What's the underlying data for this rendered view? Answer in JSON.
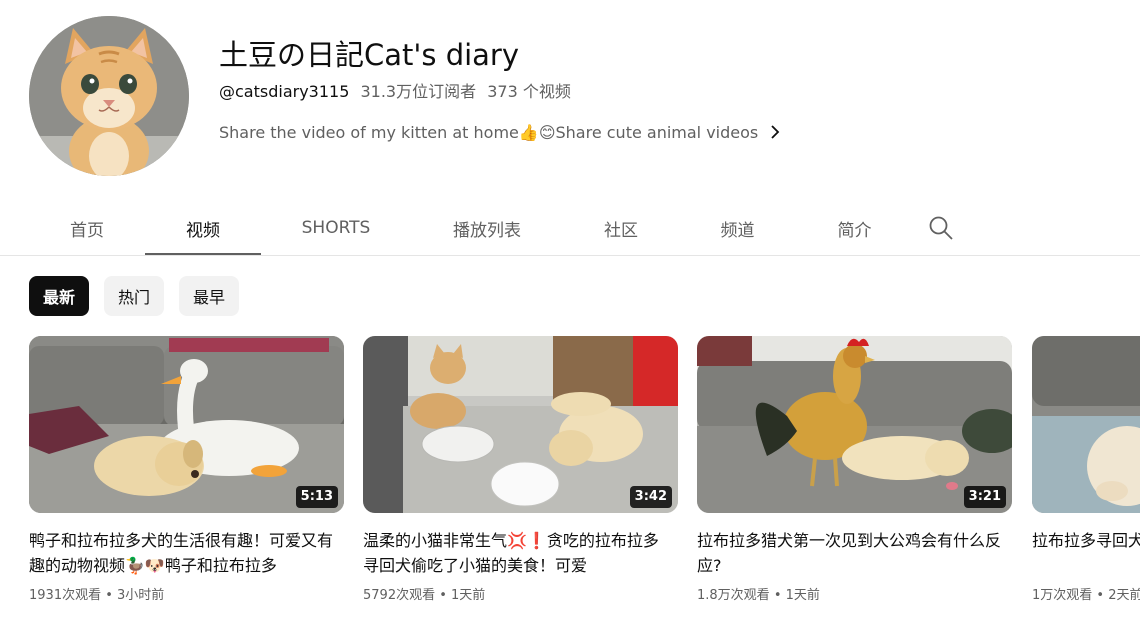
{
  "channel": {
    "title": "土豆の日記Cat's diary",
    "handle": "@catsdiary3115",
    "subscribers": "31.3万位订阅者",
    "video_count": "373 个视频",
    "description": "Share the video of my kitten at home👍😊Share cute animal videos",
    "avatar_icon": "kitten-photo",
    "more_icon": "chevron-right-icon"
  },
  "tabs": [
    {
      "label": "首页",
      "active": false
    },
    {
      "label": "视频",
      "active": true
    },
    {
      "label": "SHORTS",
      "active": false
    },
    {
      "label": "播放列表",
      "active": false
    },
    {
      "label": "社区",
      "active": false
    },
    {
      "label": "频道",
      "active": false
    },
    {
      "label": "简介",
      "active": false
    }
  ],
  "search_icon": "search-icon",
  "chips": [
    {
      "label": "最新",
      "active": true
    },
    {
      "label": "热门",
      "active": false
    },
    {
      "label": "最早",
      "active": false
    }
  ],
  "videos": [
    {
      "title": "鸭子和拉布拉多犬的生活很有趣！可爱又有趣的动物视频🦆🐶鸭子和拉布拉多",
      "duration": "5:13",
      "views": "1931次观看",
      "time": "3小时前",
      "thumbnail": "duck-and-puppy-on-sofa"
    },
    {
      "title": "温柔的小猫非常生气💢❗贪吃的拉布拉多寻回犬偷吃了小猫的美食！可爱",
      "duration": "3:42",
      "views": "5792次观看",
      "time": "1天前",
      "thumbnail": "cat-and-puppy-with-plates"
    },
    {
      "title": "拉布拉多猎犬第一次见到大公鸡会有什么反应?",
      "duration": "3:21",
      "views": "1.8万次观看",
      "time": "1天前",
      "thumbnail": "rooster-and-puppy-on-sofa"
    },
    {
      "title": "拉布拉多寻回犬小狗和小猫一起",
      "duration": "",
      "views": "1万次观看",
      "time": "2天前",
      "thumbnail": "puppy-on-blanket"
    }
  ],
  "meta_separator": " • "
}
